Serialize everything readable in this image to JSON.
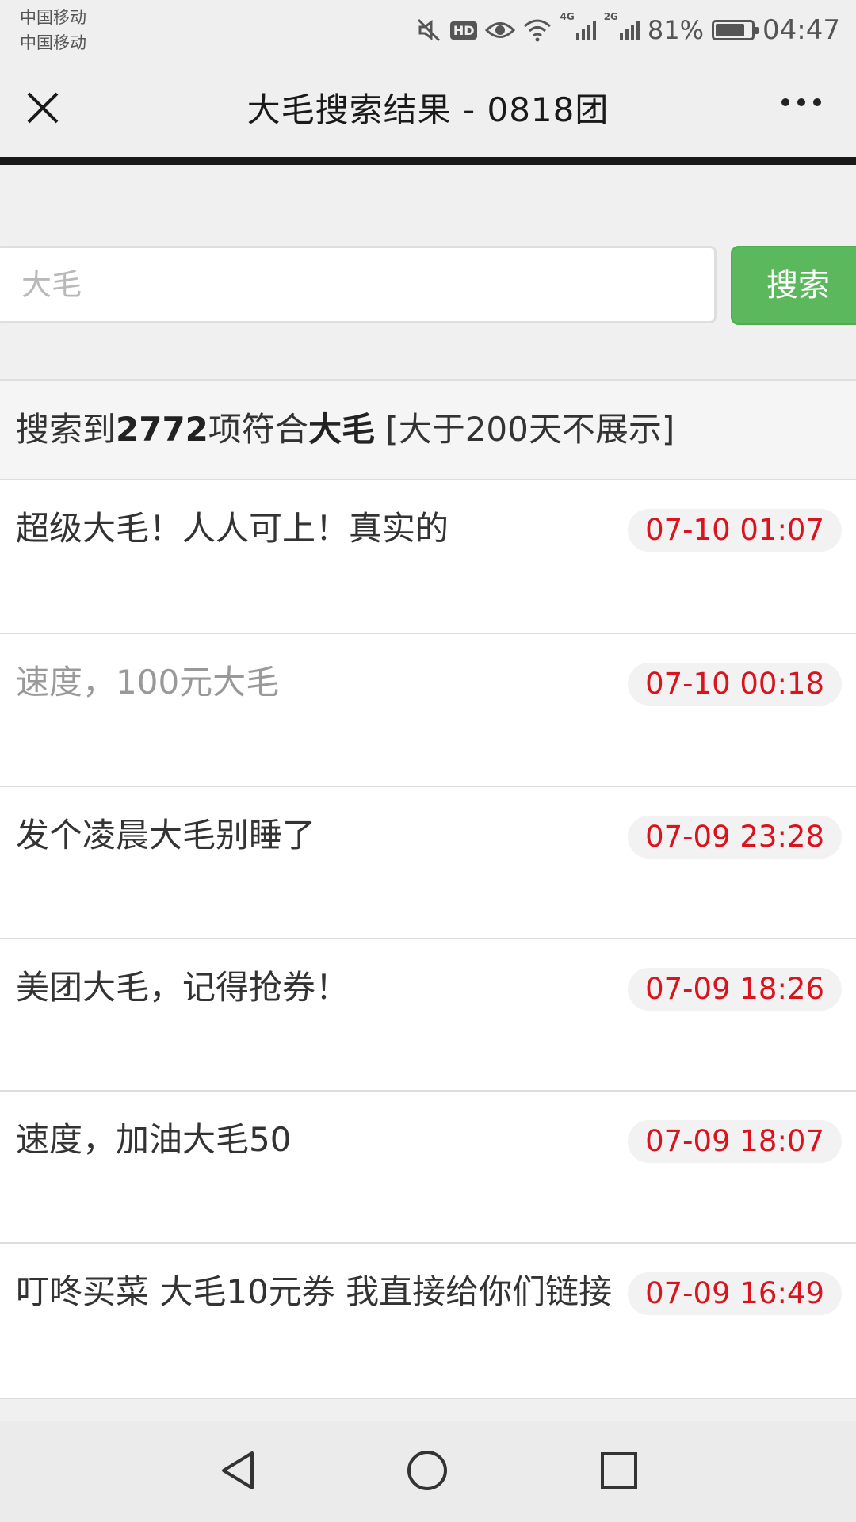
{
  "status_bar": {
    "carrier1": "中国移动",
    "carrier2": "中国移动",
    "hd_label": "HD",
    "net1": "4G",
    "net2": "2G",
    "battery_percent": "81%",
    "battery_level": 0.81,
    "time": "04:47",
    "icons": [
      "mute-icon",
      "hd-icon",
      "eye-icon",
      "wifi-icon",
      "signal-icon",
      "battery-icon"
    ]
  },
  "navbar": {
    "title": "大毛搜索结果 - 0818团"
  },
  "search": {
    "placeholder": "大毛",
    "value": "",
    "button_label": "搜索"
  },
  "summary": {
    "prefix": "搜索到",
    "count": "2772",
    "middle": "项符合",
    "keyword": "大毛",
    "suffix": " [大于200天不展示]"
  },
  "results": [
    {
      "title": "超级大毛！人人可上！真实的",
      "time": "07-10 01:07",
      "read": false
    },
    {
      "title": "速度，100元大毛",
      "time": "07-10 00:18",
      "read": true
    },
    {
      "title": "发个凌晨大毛别睡了",
      "time": "07-09 23:28",
      "read": false
    },
    {
      "title": "美团大毛，记得抢券！",
      "time": "07-09 18:26",
      "read": false
    },
    {
      "title": "速度，加油大毛50",
      "time": "07-09 18:07",
      "read": false
    },
    {
      "title": "叮咚买菜 大毛10元券 我直接给你们链接",
      "time": "07-09 16:49",
      "read": false
    }
  ],
  "colors": {
    "accent_green": "#5cb85c",
    "time_red": "#d9141e"
  }
}
